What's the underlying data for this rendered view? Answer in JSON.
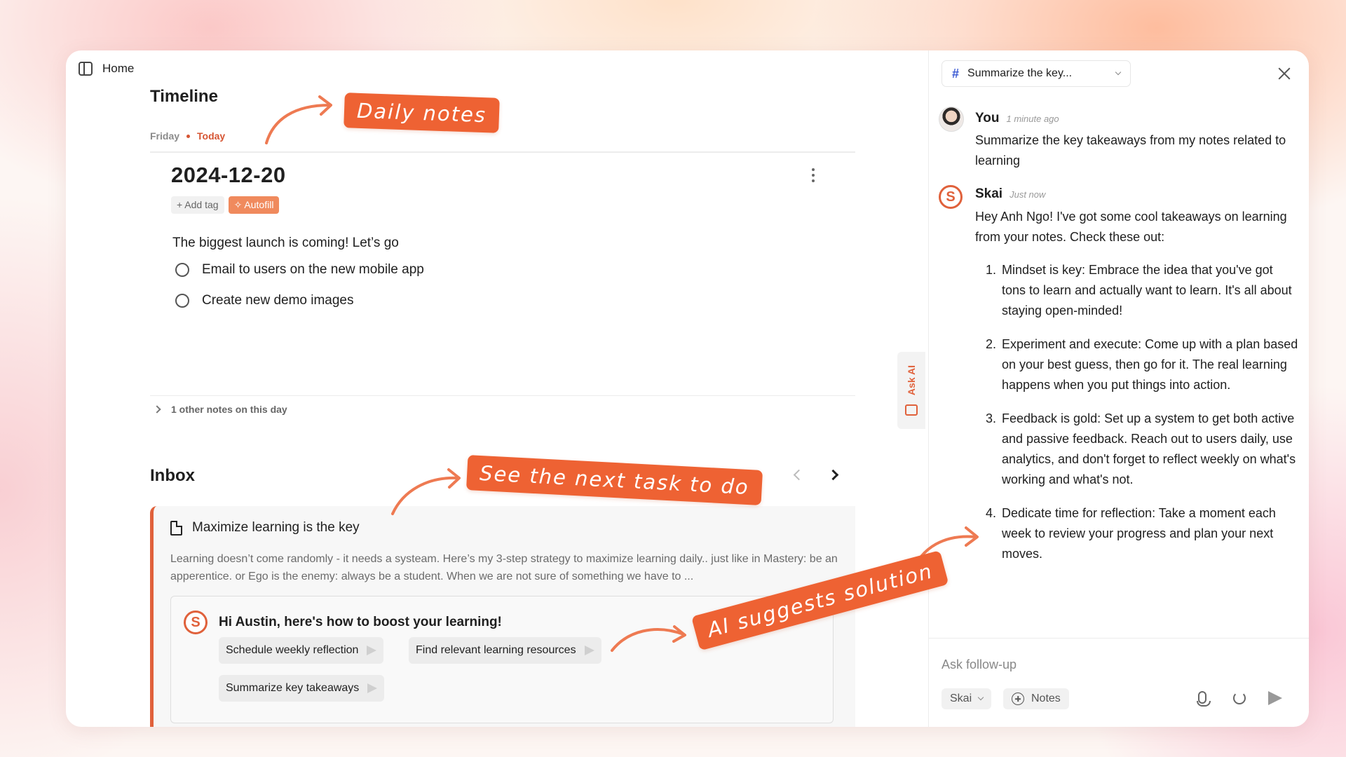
{
  "topbar": {
    "home_label": "Home"
  },
  "timeline": {
    "title": "Timeline",
    "day": "Friday",
    "today": "Today",
    "note_date": "2024-12-20",
    "add_tag": "+ Add tag",
    "autofill": "✧ Autofill",
    "body": "The biggest launch is coming! Let’s go",
    "todos": [
      "Email to users on the new mobile app",
      "Create new demo images"
    ],
    "other_notes": "1 other notes on this day"
  },
  "inbox": {
    "title": "Inbox",
    "card_title": "Maximize learning is the key",
    "excerpt": "Learning doesn’t come randomly - it needs a systeam. Here’s my 3-step strategy to maximize learning daily.. just like in Mastery: be an apperentice. or Ego is the enemy: always be a student. When we are not sure of something we have to ...",
    "ai_greeting": "Hi Austin, here's how to boost your learning!",
    "suggestions": [
      "Schedule weekly reflection",
      "Find relevant learning resources",
      "Summarize key takeaways"
    ]
  },
  "ask_ai": {
    "label": "Ask AI"
  },
  "chat": {
    "conversation_title": "Summarize the key...",
    "user": {
      "name": "You",
      "time": "1 minute ago",
      "message": "Summarize the key takeaways from my notes related to learning"
    },
    "assistant": {
      "name": "Skai",
      "time": "Just now",
      "intro": "Hey Anh Ngo! I've got some cool takeaways on learning from your notes. Check these out:",
      "items": [
        "Mindset is key: Embrace the idea that you've got tons to learn and actually want to learn. It's all about staying open-minded!",
        "Experiment and execute: Come up with a plan based on your best guess, then go for it. The real learning happens when you put things into action.",
        "Feedback is gold: Set up a system to get both active and passive feedback. Reach out to users daily, use analytics, and don't forget to reflect weekly on what's working and what's not.",
        "Dedicate time for reflection: Take a moment each week to review your progress and plan your next moves."
      ]
    },
    "composer": {
      "placeholder": "Ask follow-up",
      "model": "Skai",
      "notes": "Notes"
    }
  },
  "annotations": {
    "daily_notes": "Daily notes",
    "next_task": "See the next task to do",
    "ai_suggests": "AI suggests solution"
  },
  "colors": {
    "accent": "#e0613b",
    "callout": "#ee6233",
    "link_blue": "#3c5bd4"
  }
}
